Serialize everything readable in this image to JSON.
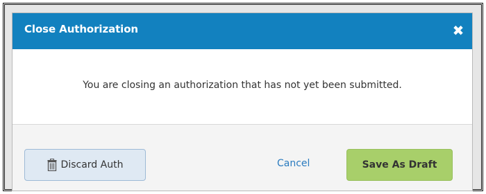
{
  "dialog": {
    "title": "Close Authorization",
    "close_icon": "close-x-icon",
    "message": "You are closing an authorization that has not yet been submitted."
  },
  "footer": {
    "discard_label": "Discard Auth",
    "discard_icon": "trash-icon",
    "cancel_label": "Cancel",
    "save_label": "Save As Draft"
  },
  "colors": {
    "titlebar": "#1281bf",
    "save_button": "#a8cf6a",
    "discard_button": "#dfe9f3",
    "cancel_link": "#2a7bbf"
  }
}
